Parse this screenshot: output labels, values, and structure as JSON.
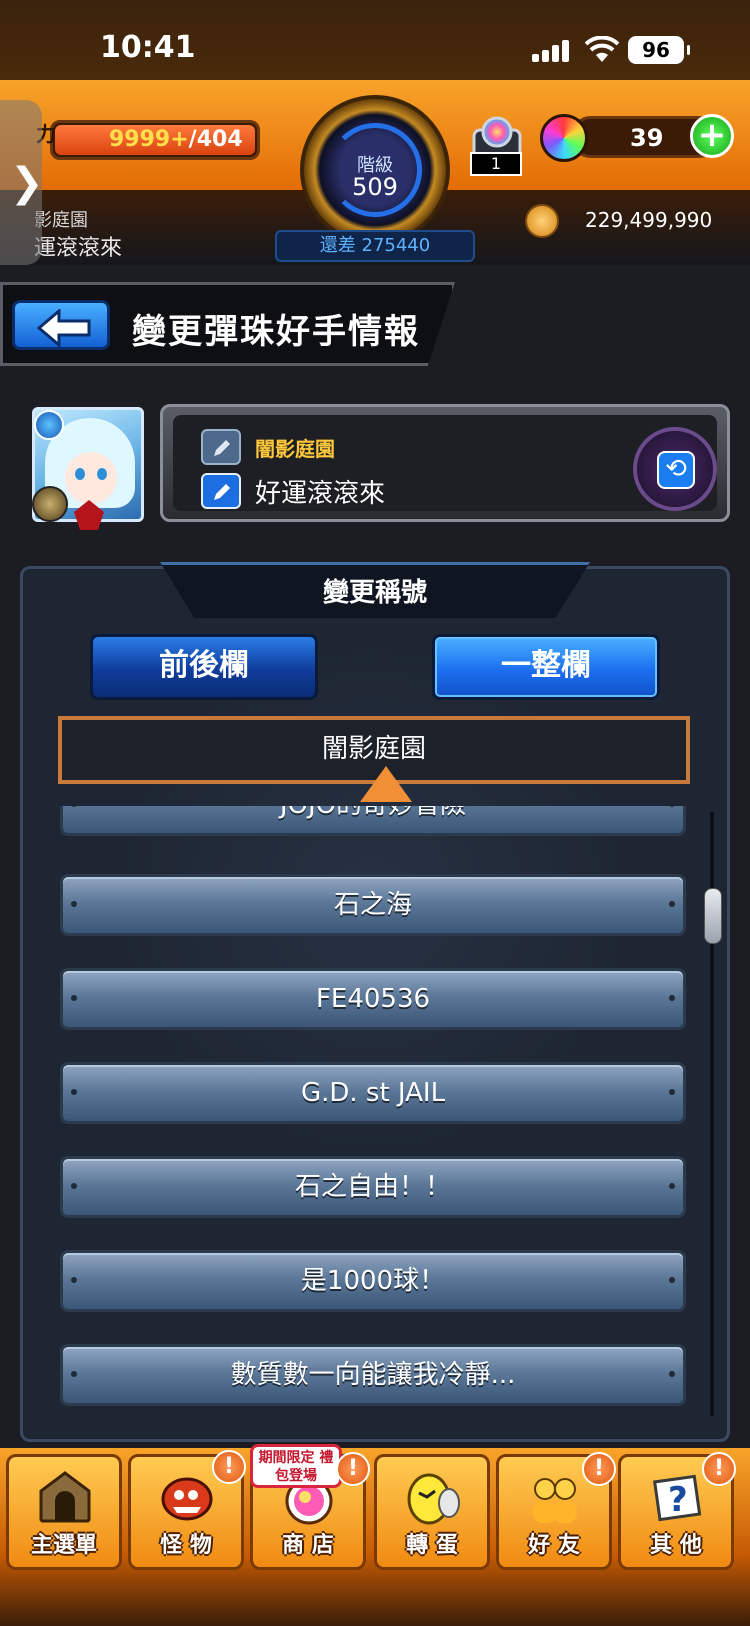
{
  "status_bar": {
    "time": "10:41",
    "battery": "96"
  },
  "header": {
    "stamina_label": "力",
    "stamina_current": "9999+",
    "stamina_max": "/404",
    "rank_label": "階級",
    "rank_value": "509",
    "rank_diff": "還差 275440",
    "gift_count": "1",
    "orb_count": "39",
    "player_subtitle": "影庭園",
    "player_name": "運滾滾來",
    "gold": "229,499,990"
  },
  "title_bar": {
    "title": "變更彈珠好手情報"
  },
  "profile": {
    "subtitle": "闇影庭園",
    "name": "好運滾滾來"
  },
  "panel": {
    "title": "變更稱號",
    "tabs": [
      {
        "label": "前後欄"
      },
      {
        "label": "一整欄"
      }
    ],
    "current_title": "闇影庭園",
    "items": [
      {
        "label": "JOJO的奇妙冒險"
      },
      {
        "label": "石之海"
      },
      {
        "label": "FE40536"
      },
      {
        "label": "G.D. st JAIL"
      },
      {
        "label": "石之自由！！"
      },
      {
        "label": "是1000球！"
      },
      {
        "label": "數質數一向能讓我冷靜..."
      }
    ]
  },
  "bottom_nav": {
    "promo": "期間限定 禮包登場",
    "items": [
      {
        "label": "主選單"
      },
      {
        "label": "怪 物"
      },
      {
        "label": "商 店"
      },
      {
        "label": "轉 蛋"
      },
      {
        "label": "好 友"
      },
      {
        "label": "其 他"
      }
    ],
    "alert_mark": "!"
  },
  "colors": {
    "accent_orange": "#f27a05",
    "title_blue": "#1c6ff0",
    "selected_border": "#c97a3a",
    "subtitle_gold": "#ffc83a"
  }
}
